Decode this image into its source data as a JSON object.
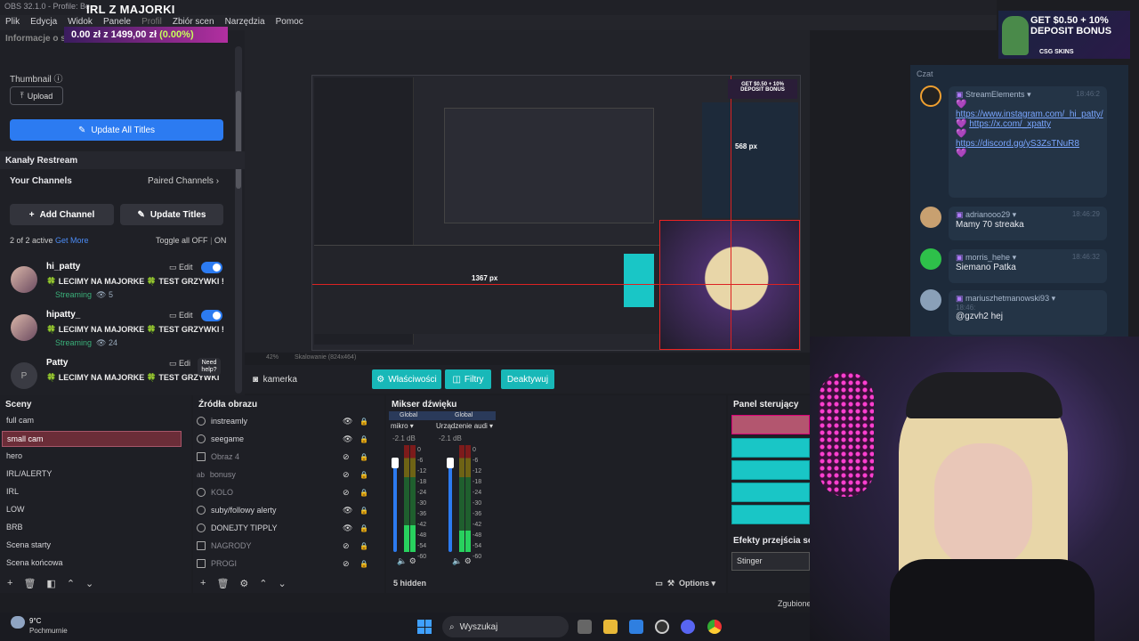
{
  "window": {
    "title": "OBS 32.1.0 - Profile: Be"
  },
  "overlay": {
    "stream_title": "IRL Z MAJORKI",
    "donation_amount": "0.00 zł",
    "donation_sep": "z",
    "donation_goal": "1499,00 zł",
    "donation_pct": "(0.00%)"
  },
  "menu": [
    "Plik",
    "Edycja",
    "Widok",
    "Panele",
    "Profil",
    "Zbiór scen",
    "Narzędzia",
    "Pomoc"
  ],
  "restream": {
    "info_header": "Informacje o strumieniu",
    "thumbnail_label": "Thumbnail",
    "upload_label": "Upload",
    "update_all_label": "Update All Titles",
    "section_title": "Kanały Restream",
    "your_channels": "Your Channels",
    "paired_channels": "Paired Channels",
    "add_channel": "Add Channel",
    "update_titles": "Update Titles",
    "active_count": "2 of 2 active",
    "get_more": "Get More",
    "toggle_all": "Toggle all",
    "off": "OFF",
    "on": "ON",
    "need_help": "Need help?",
    "channels": [
      {
        "name": "hi_patty",
        "title": "🍀 LECIMY NA MAJORKE 🍀 TEST GRZYWKI !h...",
        "status": "Streaming",
        "viewers": "5",
        "edit": "Edit"
      },
      {
        "name": "hipatty_",
        "title": "🍀 LECIMY NA MAJORKE 🍀 TEST GRZYWKI !h...",
        "status": "Streaming",
        "viewers": "24",
        "edit": "Edit"
      },
      {
        "name": "Patty",
        "title": "🍀 LECIMY NA MAJORKE 🍀 TEST GRZYWKI",
        "avatar_letter": "P",
        "edit": "Edi"
      }
    ]
  },
  "preview": {
    "zoom": "42%",
    "scaling": "Skalowanie (824x464)",
    "measure_w": "568 px",
    "measure_h": "1367 px"
  },
  "source_toolbar": {
    "source_name": "kamerka",
    "properties": "Właściwości",
    "filters": "Filtry",
    "deactivate": "Deaktywuj"
  },
  "scenes": {
    "title": "Sceny",
    "items": [
      "full cam",
      "small cam",
      "hero",
      "IRL/ALERTY",
      "IRL",
      "LOW",
      "BRB",
      "Scena starty",
      "Scena końcowa"
    ],
    "selected": "small cam"
  },
  "sources": {
    "title": "Źródła obrazu",
    "items": [
      {
        "name": "instreamly",
        "visible": true
      },
      {
        "name": "seegame",
        "visible": true
      },
      {
        "name": "Obraz 4",
        "visible": false
      },
      {
        "name": "bonusy",
        "visible": false
      },
      {
        "name": "KOLO",
        "visible": false
      },
      {
        "name": "suby/followy alerty",
        "visible": true
      },
      {
        "name": "DONEJTY TIPPLY",
        "visible": true
      },
      {
        "name": "NAGRODY",
        "visible": false
      },
      {
        "name": "PROGI",
        "visible": false
      }
    ]
  },
  "mixer": {
    "title": "Mikser dźwięku",
    "hidden": "5 hidden",
    "options": "Options",
    "channels": [
      {
        "tag": "Global",
        "name": "mikro",
        "db": "-2.1 dB",
        "level": 0.25
      },
      {
        "tag": "Global",
        "name": "Urządzenie audi",
        "db": "-2.1 dB",
        "level": 0.2
      }
    ],
    "scale": [
      "0",
      "-6",
      "-12",
      "-18",
      "-24",
      "-30",
      "-36",
      "-42",
      "-48",
      "-54",
      "-60"
    ]
  },
  "control_panel": {
    "title": "Panel sterujący",
    "transitions_title": "Efekty przejścia scen",
    "transition_value": "Stinger",
    "status": "Zgubione"
  },
  "chat": {
    "label": "Czat",
    "messages": [
      {
        "user": "StreamElements",
        "time": "18:46:2",
        "links": [
          "https://www.instagram.com/_hi_patty/",
          "https://x.com/_xpatty",
          "https://discord.gg/yS3ZsTNuR8"
        ]
      },
      {
        "user": "adrianooo29",
        "time": "18:46:29",
        "text": "Mamy 70 streaka"
      },
      {
        "user": "morris_hehe",
        "time": "18:46:32",
        "text": "Siemano Patka"
      },
      {
        "user": "mariuszhetmanowski93",
        "time": "18:46:",
        "text": "@gzvh2 hej"
      }
    ]
  },
  "ad": {
    "line1": "GET $0.50 + 10%",
    "line2": "DEPOSIT BONUS",
    "brand": "CSG SKINS"
  },
  "taskbar": {
    "temp": "9°C",
    "weather": "Pochmurnie",
    "search": "Wyszukaj"
  },
  "colors": {
    "accent": "#2c7bf1",
    "teal": "#18b8b8",
    "selected_scene": "#6b2d38",
    "streaming": "#3ab07a"
  }
}
